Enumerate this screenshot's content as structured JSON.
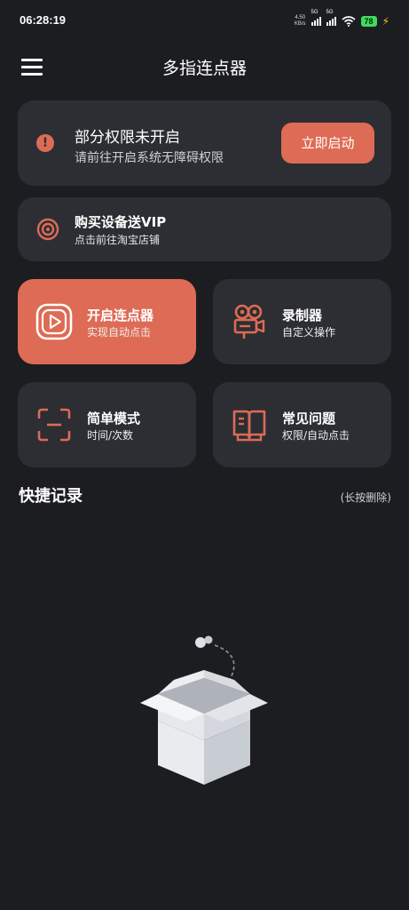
{
  "status_bar": {
    "time": "06:28:19",
    "net_speed_value": "4.50",
    "net_speed_unit": "KB/s",
    "sim1_label": "5G",
    "sim2_label": "5G",
    "battery": "78"
  },
  "header": {
    "title": "多指连点器"
  },
  "permission_card": {
    "title": "部分权限未开启",
    "subtitle": "请前往开启系统无障碍权限",
    "button_label": "立即启动",
    "icon_glyph": "!"
  },
  "vip_card": {
    "title": "购买设备送VIP",
    "subtitle": "点击前往淘宝店铺"
  },
  "tiles": [
    {
      "title": "开启连点器",
      "subtitle": "实现自动点击",
      "icon": "play-icon"
    },
    {
      "title": "录制器",
      "subtitle": "自定义操作",
      "icon": "camera-icon"
    },
    {
      "title": "简单模式",
      "subtitle": "时间/次数",
      "icon": "scan-icon"
    },
    {
      "title": "常见问题",
      "subtitle": "权限/自动点击",
      "icon": "book-icon"
    }
  ],
  "quick_records": {
    "title": "快捷记录",
    "hint": "(长按删除)"
  },
  "colors": {
    "background": "#1c1d21",
    "card": "#2c2e33",
    "accent": "#de6b55"
  }
}
